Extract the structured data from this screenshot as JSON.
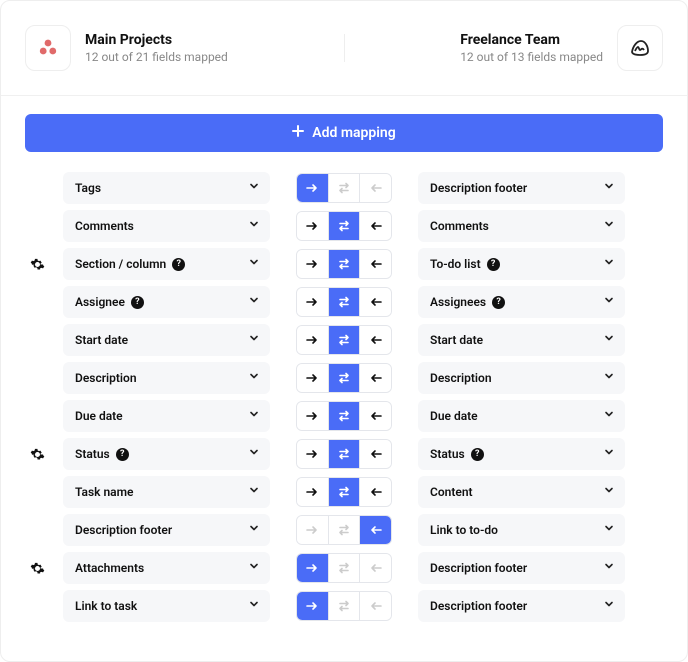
{
  "header": {
    "left": {
      "title": "Main Projects",
      "sub": "12 out of 21 fields mapped"
    },
    "right": {
      "title": "Freelance Team",
      "sub": "12 out of 13 fields mapped"
    }
  },
  "add_button_label": "Add mapping",
  "rows": [
    {
      "gear": false,
      "left": {
        "label": "Tags",
        "q": false
      },
      "dir": "right",
      "right": {
        "label": "Description footer",
        "q": false
      }
    },
    {
      "gear": false,
      "left": {
        "label": "Comments",
        "q": false
      },
      "dir": "both",
      "right": {
        "label": "Comments",
        "q": false
      }
    },
    {
      "gear": true,
      "left": {
        "label": "Section / column",
        "q": true
      },
      "dir": "both",
      "right": {
        "label": "To-do list",
        "q": true
      }
    },
    {
      "gear": false,
      "left": {
        "label": "Assignee",
        "q": true
      },
      "dir": "both",
      "right": {
        "label": "Assignees",
        "q": true
      }
    },
    {
      "gear": false,
      "left": {
        "label": "Start date",
        "q": false
      },
      "dir": "both",
      "right": {
        "label": "Start date",
        "q": false
      }
    },
    {
      "gear": false,
      "left": {
        "label": "Description",
        "q": false
      },
      "dir": "both",
      "right": {
        "label": "Description",
        "q": false
      }
    },
    {
      "gear": false,
      "left": {
        "label": "Due date",
        "q": false
      },
      "dir": "both",
      "right": {
        "label": "Due date",
        "q": false
      }
    },
    {
      "gear": true,
      "left": {
        "label": "Status",
        "q": true
      },
      "dir": "both",
      "right": {
        "label": "Status",
        "q": true
      }
    },
    {
      "gear": false,
      "left": {
        "label": "Task name",
        "q": false
      },
      "dir": "both",
      "right": {
        "label": "Content",
        "q": false
      }
    },
    {
      "gear": false,
      "left": {
        "label": "Description footer",
        "q": false
      },
      "dir": "left",
      "right": {
        "label": "Link to to-do",
        "q": false
      }
    },
    {
      "gear": true,
      "left": {
        "label": "Attachments",
        "q": false
      },
      "dir": "right",
      "right": {
        "label": "Description footer",
        "q": false
      }
    },
    {
      "gear": false,
      "left": {
        "label": "Link to task",
        "q": false
      },
      "dir": "right",
      "right": {
        "label": "Description footer",
        "q": false
      }
    }
  ]
}
